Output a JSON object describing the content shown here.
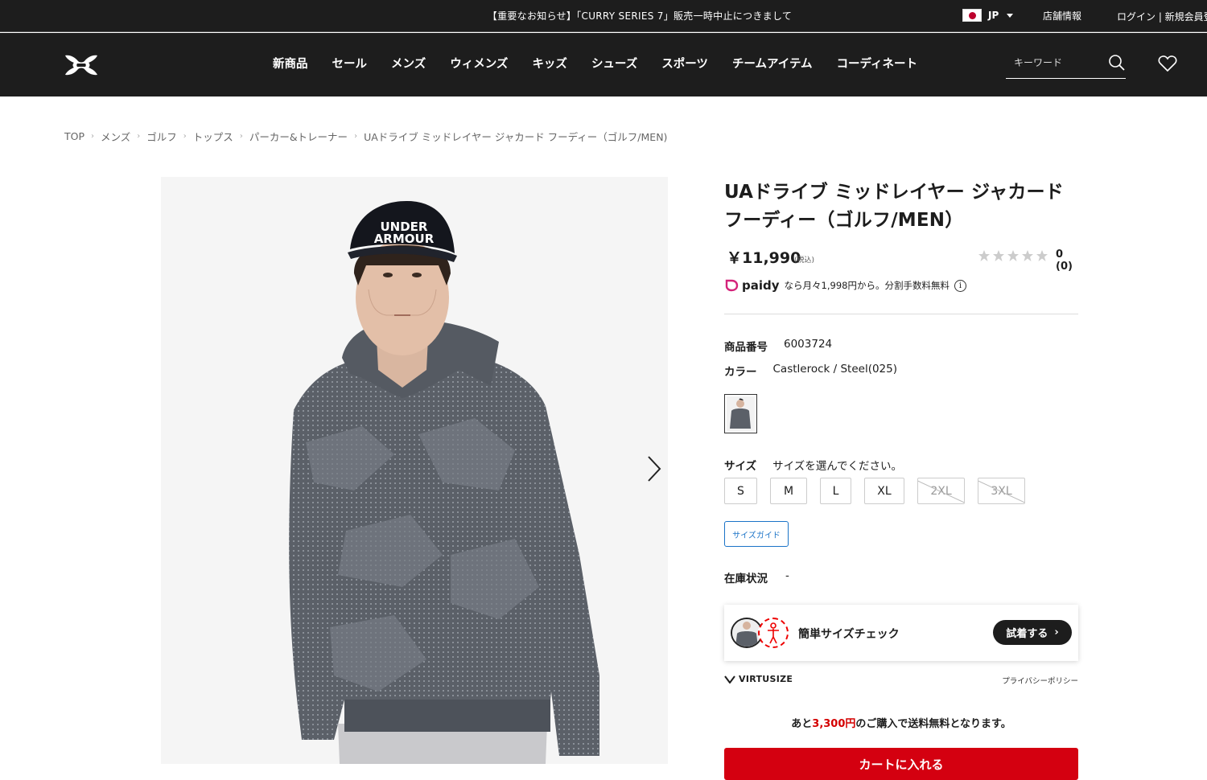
{
  "topbar": {
    "notice": "【重要なお知らせ】「CURRY SERIES 7」販売一時中止につきまして",
    "lang": "JP",
    "store": "店舗情報",
    "login": "ログイン | 新規会員登録"
  },
  "nav": {
    "items": [
      "新商品",
      "セール",
      "メンズ",
      "ウィメンズ",
      "キッズ",
      "シューズ",
      "スポーツ",
      "チームアイテム",
      "コーディネート"
    ],
    "search_placeholder": "キーワード"
  },
  "breadcrumb": [
    "TOP",
    "メンズ",
    "ゴルフ",
    "トップス",
    "パーカー&トレーナー",
    "UAドライブ ミッドレイヤー ジャカード フーディー（ゴルフ/MEN)"
  ],
  "product": {
    "title_line1": "UAドライブ ミッドレイヤー ジャカード",
    "title_line2": "フーディー（ゴルフ/MEN）",
    "price": "￥11,990",
    "tax": "(税込)",
    "rating_stars": 0,
    "rating_text": "0 (0)",
    "paidy_brand": "paidy",
    "paidy_text": "なら月々1,998円から。分割手数料無料",
    "sku_label": "商品番号",
    "sku": "6003724",
    "color_label": "カラー",
    "color": "Castlerock / Steel(025)",
    "size_label": "サイズ",
    "size_prompt": "サイズを選んでください。",
    "sizes": [
      {
        "label": "S",
        "available": true
      },
      {
        "label": "M",
        "available": true
      },
      {
        "label": "L",
        "available": true
      },
      {
        "label": "XL",
        "available": true
      },
      {
        "label": "2XL",
        "available": false
      },
      {
        "label": "3XL",
        "available": false
      }
    ],
    "size_guide": "サイズガイド",
    "stock_label": "在庫状況",
    "stock_value": "-",
    "virtusize_text": "簡単サイズチェック",
    "virtusize_button": "試着する",
    "virtusize_brand": "VIRTUSIZE",
    "privacy": "プライバシーポリシー",
    "free_ship_prefix": "あと",
    "free_ship_amount": "3,300円",
    "free_ship_suffix": "のご購入で送料無料となります。",
    "cart_button": "カートに入れる"
  },
  "colors": {
    "header_bg": "#1d1d1d",
    "accent_red": "#d40010",
    "link_blue": "#1a73c7"
  }
}
